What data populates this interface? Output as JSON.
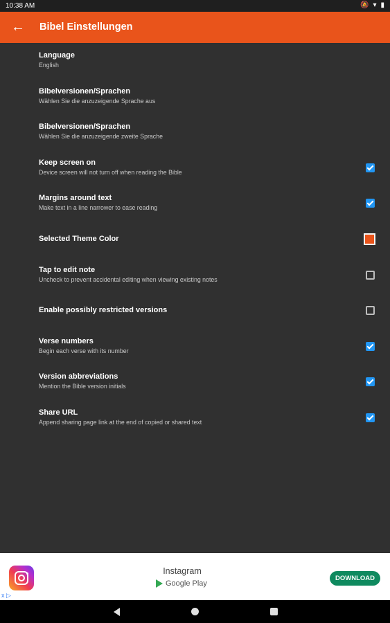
{
  "status_bar": {
    "time": "10:38 AM",
    "icons": [
      "mute-icon",
      "wifi-icon",
      "battery-icon"
    ]
  },
  "app_bar": {
    "title": "Bibel Einstellungen",
    "back_icon": "arrow-back-icon"
  },
  "accent_color": "#e9541b",
  "settings": [
    {
      "title": "Language",
      "subtitle": "English",
      "control": "none"
    },
    {
      "title": "Bibelversionen/Sprachen",
      "subtitle": "Wählen Sie die anzuzeigende Sprache aus",
      "control": "none"
    },
    {
      "title": "Bibelversionen/Sprachen",
      "subtitle": "Wählen Sie die anzuzeigende zweite Sprache",
      "control": "none"
    },
    {
      "title": "Keep screen on",
      "subtitle": "Device screen will not turn off when reading the Bible",
      "control": "checkbox",
      "checked": true
    },
    {
      "title": "Margins around text",
      "subtitle": "Make text in a line narrower to ease reading",
      "control": "checkbox",
      "checked": true
    },
    {
      "title": "Selected Theme Color",
      "subtitle": "",
      "control": "color",
      "color": "#e9541b"
    },
    {
      "title": "Tap to edit note",
      "subtitle": "Uncheck to prevent accidental editing when viewing existing notes",
      "control": "checkbox",
      "checked": false
    },
    {
      "title": "Enable possibly restricted versions",
      "subtitle": "",
      "control": "checkbox",
      "checked": false
    },
    {
      "title": "Verse numbers",
      "subtitle": "Begin each verse with its number",
      "control": "checkbox",
      "checked": true
    },
    {
      "title": "Version abbreviations",
      "subtitle": "Mention the Bible version initials",
      "control": "checkbox",
      "checked": true
    },
    {
      "title": "Share URL",
      "subtitle": "Append sharing page link at the end of copied or shared text",
      "control": "checkbox",
      "checked": true
    }
  ],
  "ad": {
    "app_name": "Instagram",
    "store": "Google Play",
    "button": "DOWNLOAD",
    "adchoices": "x ▷"
  },
  "nav_bar": {
    "icons": [
      "back-nav-icon",
      "home-nav-icon",
      "recents-nav-icon"
    ]
  }
}
